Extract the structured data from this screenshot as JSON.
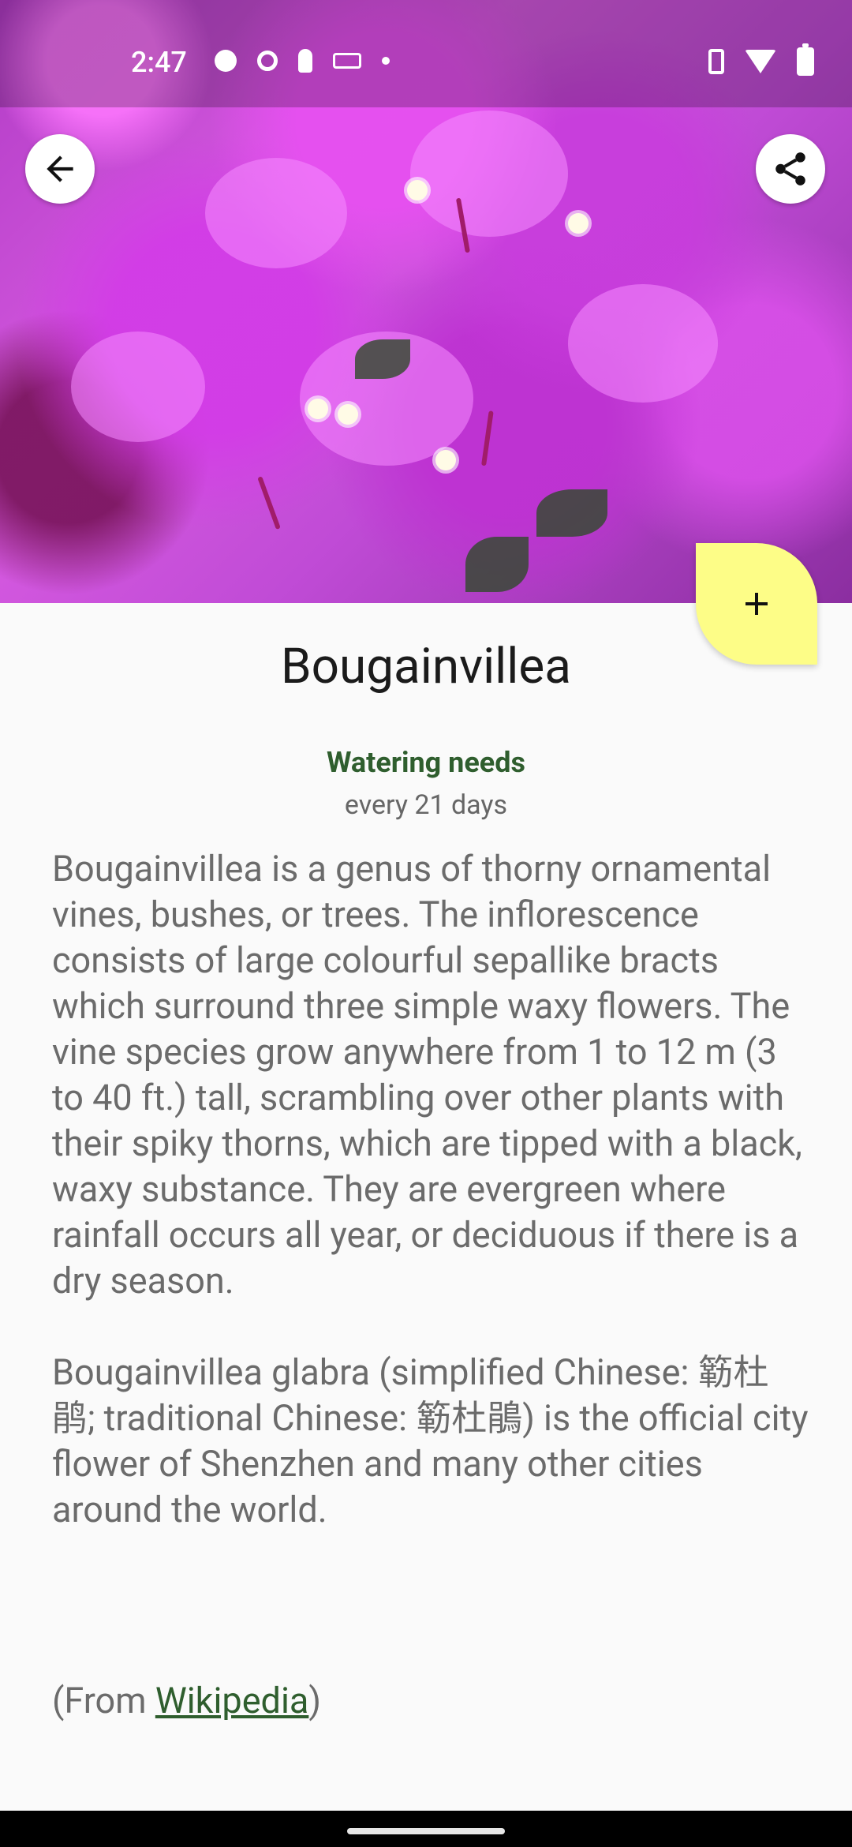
{
  "status_bar": {
    "time": "2:47"
  },
  "header": {
    "back_icon": "arrow-back-icon",
    "share_icon": "share-icon"
  },
  "fab": {
    "icon": "plus-icon",
    "color": "#fdfd87"
  },
  "plant": {
    "name": "Bougainvillea",
    "watering_label": "Watering needs",
    "watering_value": "every 21 days",
    "description_1": "Bougainvillea is a genus of thorny ornamental vines, bushes, or trees. The inflorescence consists of large colourful sepallike bracts which surround three simple waxy flowers. The vine species grow anywhere from 1 to 12 m (3 to 40 ft.) tall, scrambling over other plants with their spiky thorns, which are tipped with a black, waxy substance. They are evergreen where rainfall occurs all year, or deciduous if there is a dry season.",
    "description_2": "Bougainvillea glabra (simplified Chinese: 簕杜鹃; traditional Chinese: 簕杜鵑) is the official city flower of Shenzhen and many other cities around the world.",
    "source_prefix": "(From ",
    "source_link": "Wikipedia",
    "source_suffix": ")"
  },
  "colors": {
    "accent_green": "#2f5e2e",
    "text_gray": "#6b6b6b"
  }
}
